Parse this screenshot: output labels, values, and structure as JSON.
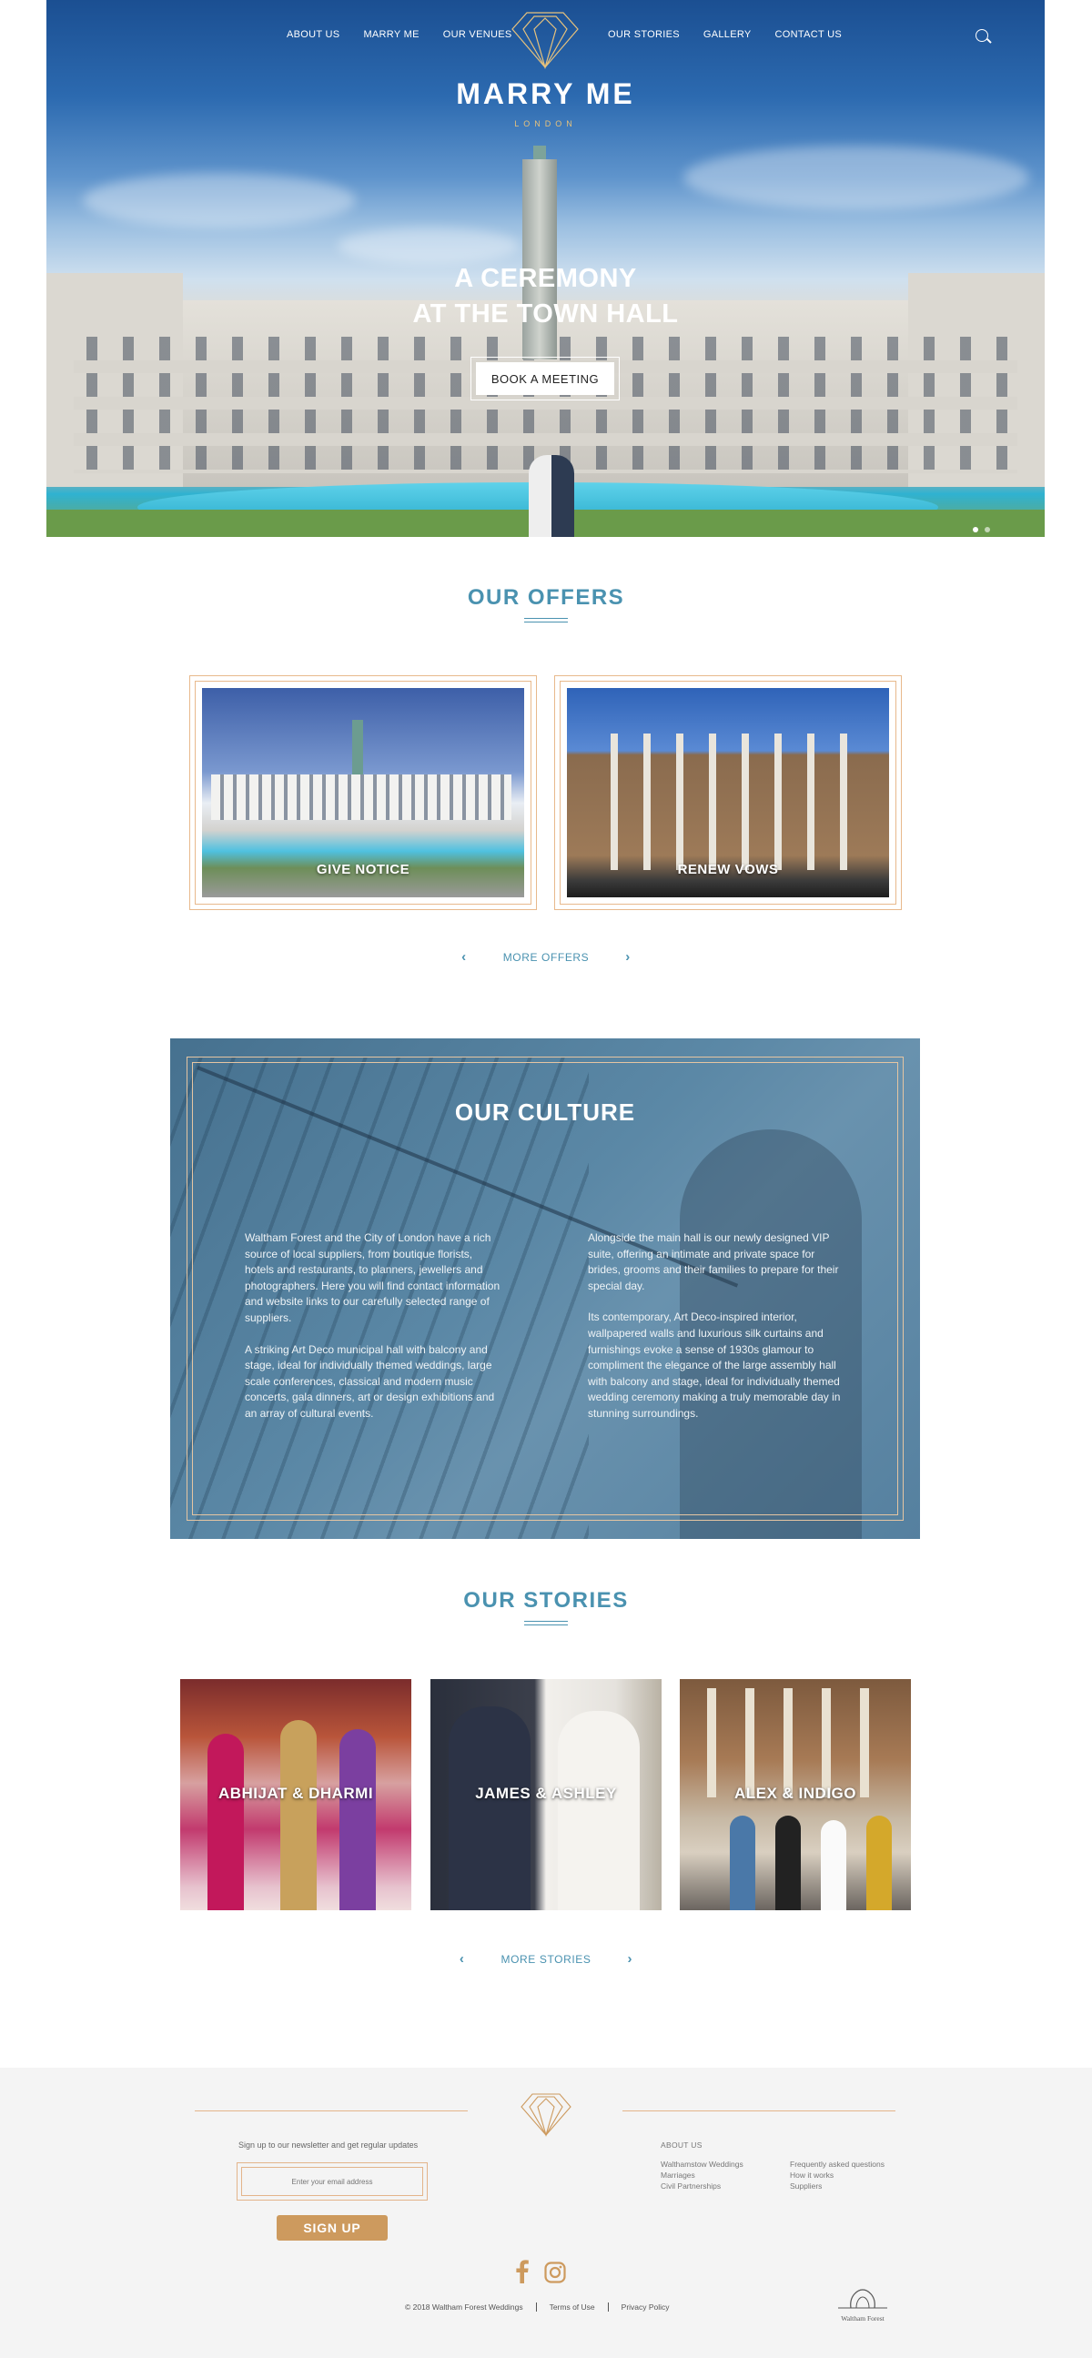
{
  "header": {
    "nav_left": [
      "ABOUT US",
      "MARRY ME",
      "OUR VENUES"
    ],
    "nav_right": [
      "OUR STORIES",
      "GALLERY",
      "CONTACT US"
    ],
    "brand": "MARRY ME",
    "brand_sub": "LONDON",
    "search_icon": "search-icon"
  },
  "hero": {
    "title_line1": "A CEREMONY",
    "title_line2": "AT THE TOWN HALL",
    "button": "BOOK A MEETING",
    "slide_count": 2,
    "active_slide": 1
  },
  "offers": {
    "title": "OUR OFFERS",
    "cards": [
      {
        "label": "GIVE NOTICE"
      },
      {
        "label": "RENEW VOWS"
      }
    ],
    "more": "MORE OFFERS"
  },
  "culture": {
    "title": "OUR CULTURE",
    "col1_p1": "Waltham Forest and the City of London have a rich source of local suppliers, from boutique florists, hotels and restaurants, to planners, jewellers and photographers. Here you will find contact information and website links to our carefully selected range of suppliers.",
    "col1_p2": "A striking Art Deco municipal hall with balcony and stage, ideal for individually themed weddings, large scale conferences, classical and modern music concerts, gala dinners, art or design exhibitions and an array of cultural events.",
    "col2_p1": "Alongside the main hall is our newly designed VIP suite, offering an intimate and private space for brides, grooms and their families to prepare for their special day.",
    "col2_p2": "Its contemporary, Art Deco-inspired interior, wallpapered walls and luxurious silk curtains and furnishings evoke a sense of 1930s glamour to compliment the elegance of the large assembly hall with balcony and stage, ideal for individually themed wedding ceremony making a truly memorable day in stunning surroundings."
  },
  "stories": {
    "title": "OUR STORIES",
    "cards": [
      {
        "label": "ABHIJAT & DHARMI"
      },
      {
        "label": "JAMES & ASHLEY"
      },
      {
        "label": "ALEX & INDIGO"
      }
    ],
    "more": "MORE STORIES"
  },
  "footer": {
    "newsletter_text": "Sign up to our newsletter and get regular updates",
    "email_placeholder": "Enter your email address",
    "signup": "SIGN UP",
    "about_heading": "ABOUT US",
    "col1": [
      "Walthamstow Weddings",
      "Marriages",
      "Civil Partnerships"
    ],
    "col2": [
      "Frequently asked questions",
      "How it works",
      "Suppliers"
    ],
    "copyright": "© 2018 Waltham Forest Weddings",
    "terms": "Terms of Use",
    "privacy": "Privacy Policy",
    "partner_logo": "Waltham Forest",
    "colors": {
      "accent": "#4a92b0",
      "gold": "#cd9a5e",
      "frame": "#e3b48a"
    }
  }
}
